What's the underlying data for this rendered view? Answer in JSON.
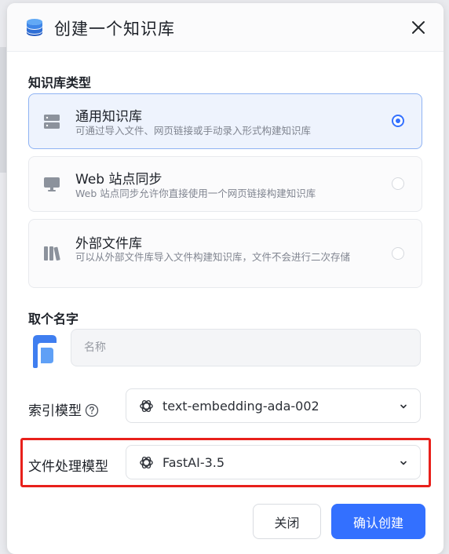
{
  "dialog": {
    "title": "创建一个知识库",
    "icon": "database-icon"
  },
  "type_section": {
    "label": "知识库类型",
    "options": [
      {
        "name": "通用知识库",
        "desc": "可通过导入文件、网页链接或手动录入形式构建知识库",
        "icon": "database-stack-icon",
        "selected": true
      },
      {
        "name": "Web 站点同步",
        "desc": "Web 站点同步允许你直接使用一个网页链接构建知识库",
        "icon": "monitor-icon",
        "selected": false
      },
      {
        "name": "外部文件库",
        "desc": "可以从外部文件库导入文件构建知识库，文件不会进行二次存储",
        "icon": "books-icon",
        "selected": false
      }
    ]
  },
  "name_section": {
    "label": "取个名字",
    "placeholder": "名称",
    "value": ""
  },
  "index_model": {
    "label": "索引模型",
    "value": "text-embedding-ada-002"
  },
  "file_model": {
    "label": "文件处理模型",
    "value": "FastAI-3.5"
  },
  "buttons": {
    "cancel": "关闭",
    "confirm": "确认创建"
  },
  "colors": {
    "accent": "#3370ff",
    "highlight": "#e8201b",
    "selected_bg": "#eef3fd"
  }
}
